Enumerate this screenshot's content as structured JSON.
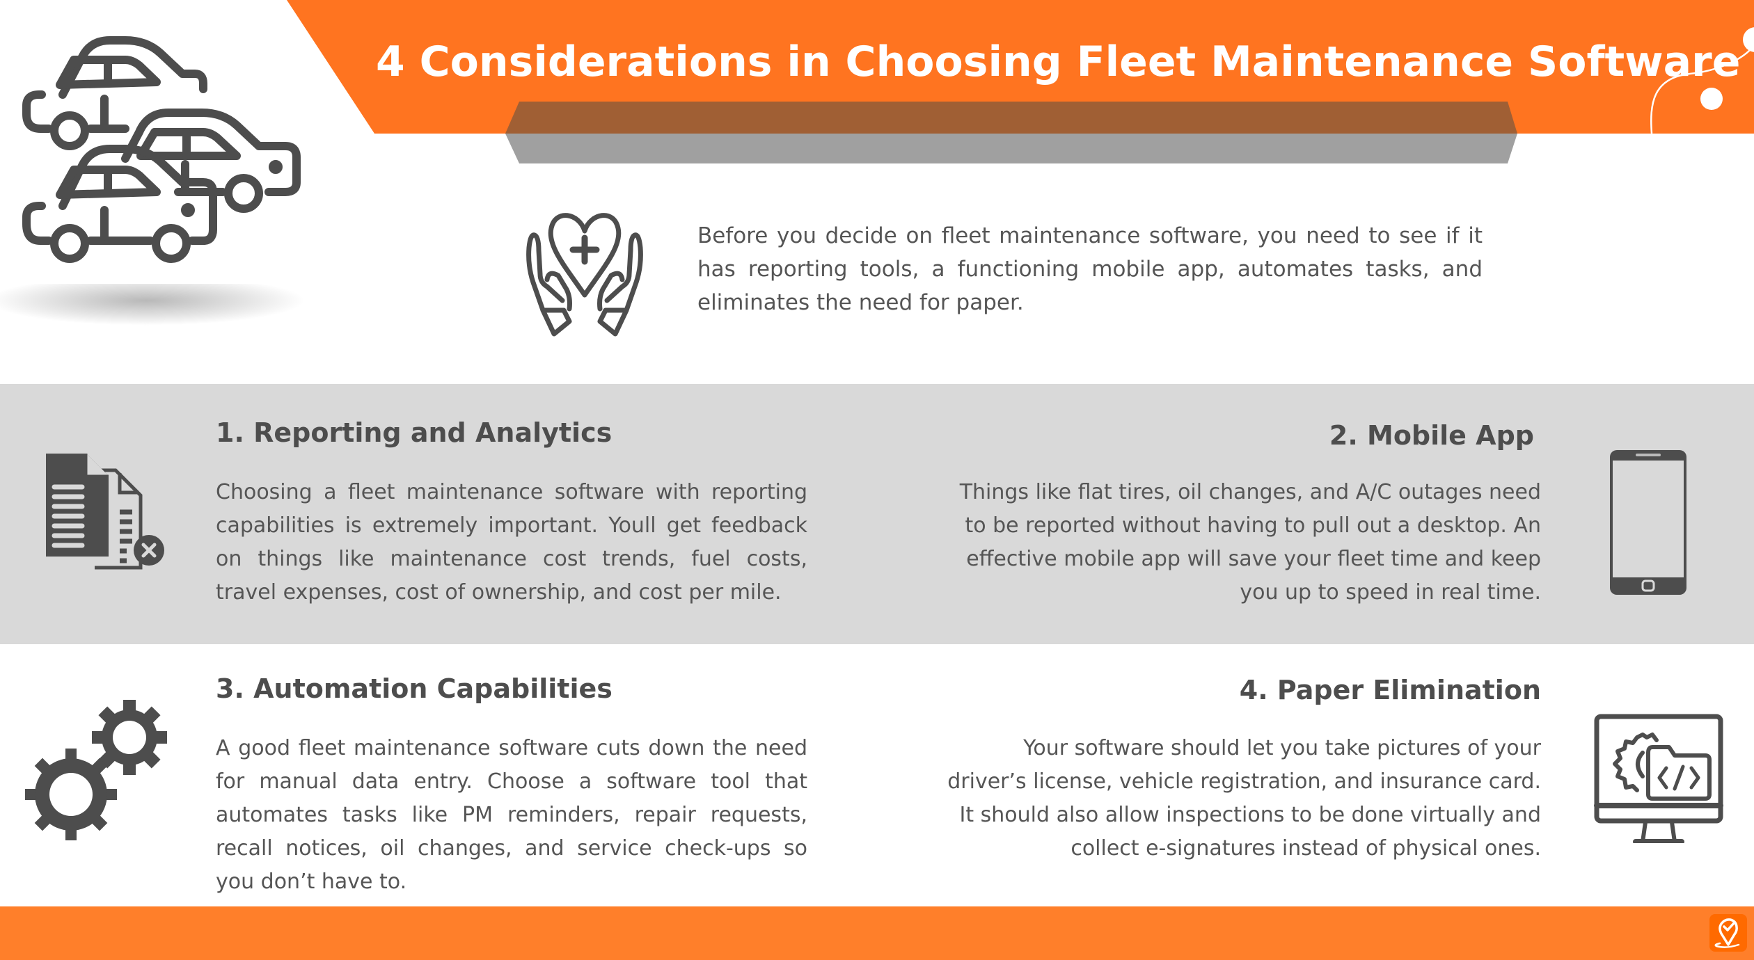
{
  "header": {
    "title": "4 Considerations in Choosing Fleet Maintenance Software"
  },
  "intro": {
    "text": "Before you decide on fleet maintenance software, you need to see if it has reporting tools, a functioning mobile app, automates tasks, and eliminates the need for paper."
  },
  "sections": [
    {
      "title": "1.  Reporting and Analytics",
      "body": "Choosing a fleet maintenance software with reporting capabilities is extremely important. Youll get feedback on things like maintenance cost trends, fuel costs, travel expenses, cost of ownership, and cost per mile.",
      "icon": "documents-report-icon"
    },
    {
      "title": "2.  Mobile App",
      "body": "Things like flat tires, oil changes, and A/C outages need to be reported without having to pull out a desktop. An effective mobile app will save your fleet time and keep you up to speed in real time.",
      "icon": "smartphone-icon"
    },
    {
      "title": "3.  Automation Capabilities",
      "body": "A good fleet maintenance software cuts down the need for manual data entry. Choose a software tool that automates tasks like PM reminders, repair requests, recall notices, oil changes, and service check-ups so you don’t have to.",
      "icon": "gears-icon"
    },
    {
      "title": "4.  Paper Elimination",
      "body": "Your software should let you take pictures of your driver’s license, vehicle registration, and insurance card. It should also allow inspections to be done virtually and collect e-signatures instead of physical ones.",
      "icon": "monitor-code-icon"
    }
  ],
  "colors": {
    "brand_orange": "#ff7420",
    "ribbon_brown": "#a05f34",
    "ribbon_gray": "#a0a0a0",
    "band_gray": "#d9d9d9",
    "icon_gray": "#4d4d4d",
    "footer_orange": "#ff7f2a"
  }
}
